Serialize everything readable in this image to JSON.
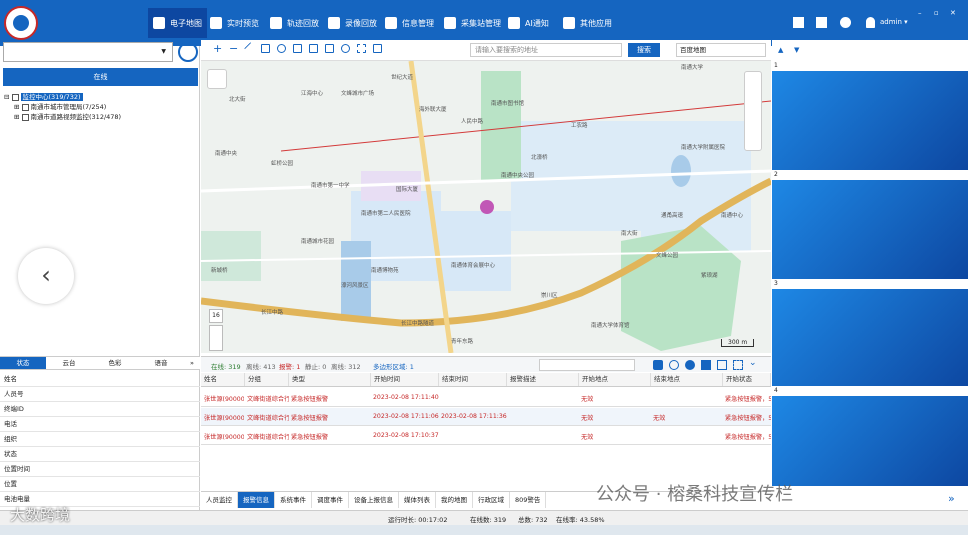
{
  "nav": {
    "title": "电子地图",
    "items": [
      "实时预览",
      "轨迹回放",
      "录像回放",
      "信息管理",
      "采集站管理",
      "AI通知",
      "其他应用"
    ],
    "user": "admin ▾",
    "window_controls": [
      "–",
      "▫",
      "✕"
    ]
  },
  "left": {
    "online_label": "在线",
    "tree": {
      "root": "监控中心(319/732)",
      "children": [
        "南通市城市管理局(7/254)",
        "南通市道路视频监控(312/478)"
      ]
    },
    "info_tabs": [
      "状态",
      "云台",
      "色彩",
      "语音"
    ],
    "properties": [
      "姓名",
      "人员号",
      "终端ID",
      "电话",
      "组织",
      "状态",
      "位置时间",
      "位置",
      "电池电量"
    ]
  },
  "map": {
    "search_placeholder": "请输入要搜索的地址",
    "search_label": "搜索",
    "map_type": "百度地图",
    "labels": [
      "世纪大道",
      "江海中心",
      "文峰城市广场",
      "南通市图书馆",
      "海外联大厦",
      "北大街",
      "南通大学",
      "南通中央公园",
      "国际大厦",
      "南通中央",
      "虹桥公园",
      "南通市第一中学",
      "南通大学附属医院",
      "南通中心",
      "长江中路",
      "濠河风景区",
      "南通城市花园",
      "南通博物苑",
      "青年东路",
      "工农路",
      "人民中路",
      "南通市第二人民医院",
      "南通体育会展中心",
      "南大街",
      "文峰公园",
      "南通大学体育馆",
      "长江中路隧道",
      "紫琅湖",
      "崇川区",
      "新城桥",
      "通甬高速",
      "北濠桥"
    ],
    "scale": "300 m",
    "zoom": "16"
  },
  "status": {
    "online": "在线: 319",
    "offline": "离线: 413",
    "alarm": "报警: 1",
    "forbid": "静止: 0",
    "disabled": "离线: 312",
    "multi_area": "多边形区域: 1"
  },
  "table": {
    "headers": [
      "姓名",
      "分组",
      "类型",
      "开始时间",
      "结束时间",
      "报警描述",
      "开始地点",
      "结束地点",
      "开始状态"
    ],
    "rows": [
      {
        "name": "张世源(900009",
        "group": "文峰街道综合行",
        "type": "紧急按钮报警",
        "start": "2023-02-08 17:11:40",
        "end": "",
        "desc": "",
        "from": "无效",
        "to": "",
        "state": "紧急按钮报警，5"
      },
      {
        "name": "张世源(900009",
        "group": "文峰街道综合行",
        "type": "紧急按钮报警",
        "start": "2023-02-08 17:11:06",
        "end": "2023-02-08 17:11:36",
        "desc": "",
        "from": "无效",
        "to": "无效",
        "state": "紧急按钮报警，5"
      },
      {
        "name": "张世源(900009",
        "group": "文峰街道综合行",
        "type": "紧急按钮报警",
        "start": "2023-02-08 17:10:37",
        "end": "",
        "desc": "",
        "from": "无效",
        "to": "",
        "state": "紧急按钮报警，5"
      }
    ]
  },
  "bottom_tabs": [
    "人员监控",
    "报警信息",
    "系统事件",
    "调度事件",
    "设备上报信息",
    "媒体列表",
    "我的地图",
    "行政区域",
    "809警告"
  ],
  "video": {
    "labels": [
      "1",
      "2",
      "3",
      "4"
    ]
  },
  "footer": {
    "runtime": "运行时长: 00:17:02",
    "online": "在线数: 319",
    "total": "总数: 732",
    "rate": "在线率: 43.58%"
  },
  "watermark": "公众号 · 榕桑科技宣传栏",
  "watermark2": "大数跨境",
  "colors": {
    "primary": "#1565c0",
    "alarm": "#c62828"
  }
}
